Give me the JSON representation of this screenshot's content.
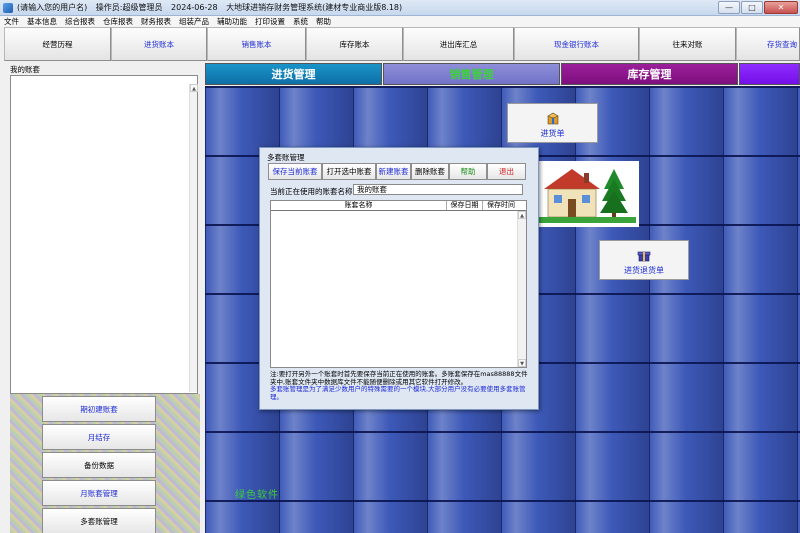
{
  "titlebar": {
    "user": "(请输入您的用户名)",
    "operator": "操作员:超级管理员",
    "date": "2024-06-28",
    "app": "大地球进销存财务管理系统(建材专业商业版8.18)",
    "btn_min": "—",
    "btn_max": "□",
    "btn_close": "✕"
  },
  "menu": [
    "文件",
    "基本信息",
    "综合报表",
    "仓库报表",
    "财务报表",
    "组装产品",
    "辅助功能",
    "打印设置",
    "系统",
    "帮助"
  ],
  "toolbar": [
    "经营历程",
    "进货账本",
    "销售账本",
    "库存账本",
    "进出库汇总",
    "现金银行账本",
    "往来对账",
    "存货查询"
  ],
  "left": {
    "label": "我的账套",
    "buttons": [
      "期初建账套",
      "月结存",
      "备份数据",
      "月账套管理",
      "多套账管理"
    ]
  },
  "tabs": {
    "purchase": "进货管理",
    "sales": "销售管理",
    "stock": "库存管理"
  },
  "features": {
    "purchase_order": "进货单",
    "purchase_return": "进货退货单"
  },
  "brand": "绿色软件",
  "dialog": {
    "title": "多套账管理",
    "buttons": [
      "保存当前账套",
      "打开选中账套",
      "新建账套",
      "删除账套",
      "帮助",
      "退出"
    ],
    "current_label": "当前正在使用的账套名称:",
    "current_value": "我的账套",
    "columns": [
      "账套名称",
      "保存日期",
      "保存时间"
    ],
    "note_1": "注:要打开另外一个账套时首先要保存当前正在使用的账套。多账套保存在mas88888文件夹中,账套文件夹中数据库文件不能随便删除或用其它软件打开修改。",
    "note_2": "多套账管理是为了满足少数用户的特殊需要的一个模块,大部分用户没有必要使用多套账管理。"
  },
  "colors": {
    "accent_blue": "#1c2ad6",
    "purchase_tab": "#1287bf",
    "sales_tab": "#8080d0",
    "stock_tab": "#8a128a"
  }
}
